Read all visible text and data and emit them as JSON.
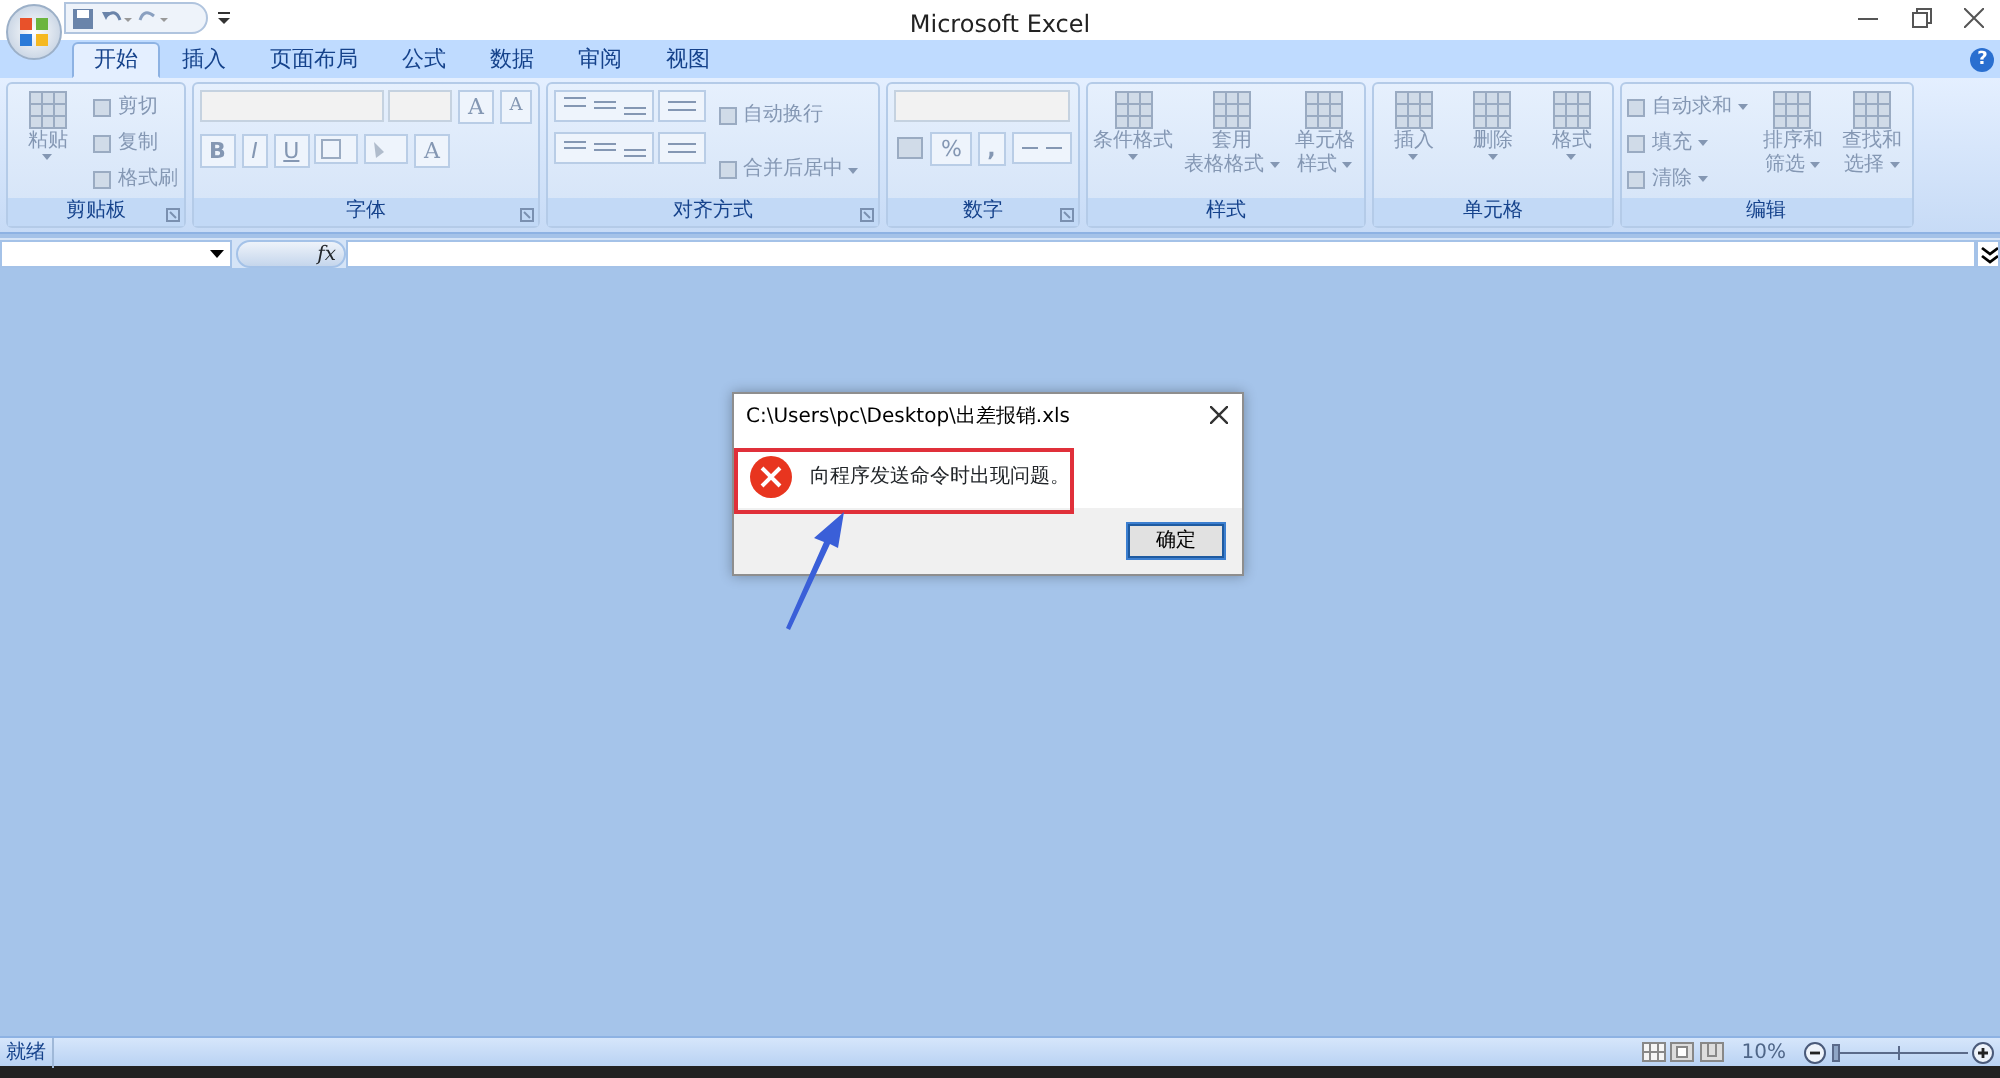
{
  "window": {
    "title": "Microsoft Excel"
  },
  "tabs": [
    {
      "label": "开始",
      "selected": true
    },
    {
      "label": "插入",
      "selected": false
    },
    {
      "label": "页面布局",
      "selected": false
    },
    {
      "label": "公式",
      "selected": false
    },
    {
      "label": "数据",
      "selected": false
    },
    {
      "label": "审阅",
      "selected": false
    },
    {
      "label": "视图",
      "selected": false
    }
  ],
  "help": "?",
  "ribbon_groups": [
    {
      "label": "剪贴板",
      "launcher": true,
      "items": [
        {
          "kind": "big",
          "lines": [
            "粘贴"
          ],
          "dropdown": true
        },
        {
          "kind": "stack",
          "entries": [
            {
              "label": "剪切",
              "dropdown": false
            },
            {
              "label": "复制",
              "dropdown": false
            },
            {
              "label": "格式刷",
              "dropdown": false
            }
          ]
        }
      ]
    },
    {
      "label": "字体",
      "launcher": true,
      "items": [
        {
          "kind": "font",
          "glyphs": [
            "A",
            "A",
            "B",
            "I",
            "U",
            "A"
          ]
        }
      ]
    },
    {
      "label": "对齐方式",
      "launcher": true,
      "items": [
        {
          "kind": "align"
        },
        {
          "kind": "stack",
          "entries": [
            {
              "label": "自动换行",
              "dropdown": false
            },
            {
              "label": "合并后居中",
              "dropdown": true
            }
          ]
        }
      ]
    },
    {
      "label": "数字",
      "launcher": true,
      "items": [
        {
          "kind": "number",
          "glyphs": [
            "%",
            ","
          ]
        }
      ]
    },
    {
      "label": "样式",
      "launcher": false,
      "items": [
        {
          "kind": "big",
          "lines": [
            "条件格式"
          ],
          "dropdown": true
        },
        {
          "kind": "big",
          "lines": [
            "套用",
            "表格格式"
          ],
          "dropdown": true
        },
        {
          "kind": "big",
          "lines": [
            "单元格",
            "样式"
          ],
          "dropdown": true
        }
      ]
    },
    {
      "label": "单元格",
      "launcher": false,
      "items": [
        {
          "kind": "big",
          "lines": [
            "插入"
          ],
          "dropdown": true
        },
        {
          "kind": "big",
          "lines": [
            "删除"
          ],
          "dropdown": true
        },
        {
          "kind": "big",
          "lines": [
            "格式"
          ],
          "dropdown": true
        }
      ]
    },
    {
      "label": "编辑",
      "launcher": false,
      "items": [
        {
          "kind": "stack",
          "entries": [
            {
              "label": "自动求和",
              "dropdown": true
            },
            {
              "label": "填充",
              "dropdown": true
            },
            {
              "label": "清除",
              "dropdown": true
            }
          ]
        },
        {
          "kind": "big",
          "lines": [
            "排序和",
            "筛选"
          ],
          "dropdown": true
        },
        {
          "kind": "big",
          "lines": [
            "查找和",
            "选择"
          ],
          "dropdown": true
        }
      ]
    }
  ],
  "formula_bar": {
    "fx": "fx"
  },
  "dialog": {
    "title": "C:\\Users\\pc\\Desktop\\出差报销.xls",
    "message": "向程序发送命令时出现问题。",
    "button": "确定"
  },
  "status_bar": {
    "text": "就绪",
    "zoom": "10%",
    "zoom_slider": {
      "level": 0.0
    }
  }
}
